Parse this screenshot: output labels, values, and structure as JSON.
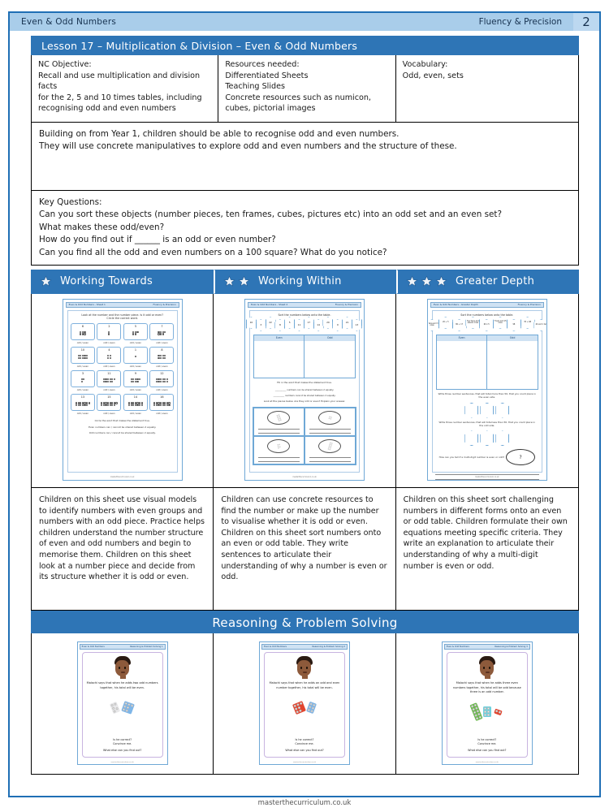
{
  "header": {
    "left_title": "Even & Odd Numbers",
    "right_title": "Fluency & Precision",
    "page_number": "2"
  },
  "lesson": {
    "title": "Lesson 17 – Multiplication & Division – Even & Odd Numbers"
  },
  "info": {
    "nc_objective": {
      "heading": "NC Objective:",
      "lines": [
        "Recall and use multiplication and division facts",
        "for the 2, 5 and 10 times tables, including",
        "recognising odd and even numbers"
      ]
    },
    "resources": {
      "heading": "Resources needed:",
      "lines": [
        "Differentiated Sheets",
        "Teaching Slides",
        "Concrete resources such as numicon,",
        "cubes, pictorial images"
      ]
    },
    "vocabulary": {
      "heading": "Vocabulary:",
      "lines": [
        "Odd, even, sets"
      ]
    }
  },
  "overview": {
    "lines": [
      "Building on from Year 1, children should be able to recognise odd and even numbers.",
      "They will use concrete manipulatives to explore odd and even numbers and the structure of these."
    ]
  },
  "key_questions": {
    "heading": "Key Questions:",
    "lines": [
      "Can you sort these objects (number pieces, ten frames, cubes, pictures etc) into an odd set and an even set?",
      "What makes these odd/even?",
      "How do you find out if ______ is an odd or even number?",
      "Can you find all the odd and even numbers on a 100 square? What do you notice?"
    ]
  },
  "differentiation": [
    {
      "label": "Working Towards",
      "stars": 1,
      "description": "Children on this sheet use visual models to identify numbers with even groups and numbers with an odd piece. Practice helps children understand the number structure of even and odd numbers and begin to memorise them. Children on this sheet look at a number piece and decide from its structure whether it is odd or even."
    },
    {
      "label": "Working Within",
      "stars": 2,
      "description": "Children can use concrete resources to find the number or make up the number to visualise whether it is odd or even. Children on this sheet sort numbers onto an even or odd table. They write sentences to articulate their understanding of why a number is even or odd."
    },
    {
      "label": "Greater Depth",
      "stars": 3,
      "description": "Children on this sheet sort challenging numbers in different forms onto an even or odd table. Children formulate their own equations meeting specific criteria. They write an explanation to articulate their understanding of why a multi-digit number is even or odd."
    }
  ],
  "worksheets": [
    {
      "head_left": "Even & Odd Numbers - Sheet 1",
      "head_right": "Fluency & Precision",
      "title_lines": [
        "Look at the number and the number piece. Is it odd or even?",
        "Circle the correct word."
      ],
      "cards": [
        {
          "number": "6",
          "shape": 6,
          "label": "odd / even"
        },
        {
          "number": "2",
          "shape": 2,
          "label": "odd / even"
        },
        {
          "number": "5",
          "shape": 5,
          "label": "odd / even"
        },
        {
          "number": "7",
          "shape": 7,
          "label": "odd / even"
        },
        {
          "number": "10",
          "shape": 10,
          "label": "odd / even"
        },
        {
          "number": "4",
          "shape": 4,
          "label": "odd / even"
        },
        {
          "number": "1",
          "shape": 1,
          "label": "odd / even"
        },
        {
          "number": "8",
          "shape": 8,
          "label": "odd / even"
        },
        {
          "number": "3",
          "shape": 3,
          "label": "odd / even"
        },
        {
          "number": "11",
          "shape": 11,
          "label": "odd / even"
        },
        {
          "number": "9",
          "shape": 9,
          "label": "odd / even"
        },
        {
          "number": "12",
          "shape": 12,
          "label": "odd / even"
        },
        {
          "number": "13",
          "shape": 13,
          "label": "odd / even"
        },
        {
          "number": "15",
          "shape": 15,
          "label": "odd / even"
        },
        {
          "number": "14",
          "shape": 14,
          "label": "odd / even"
        },
        {
          "number": "16",
          "shape": 16,
          "label": "odd / even"
        }
      ],
      "statement_intro": "Circle the word that makes the statement true.",
      "statements": [
        "Even numbers can / cannot be shared between 2 equally.",
        "Odd numbers can / cannot be shared between 2 equally."
      ],
      "footer": "masterthecurriculum.co.uk"
    },
    {
      "head_left": "Even & Odd Numbers - Sheet 2",
      "head_right": "Fluency & Precision",
      "title_lines": [
        "Sort the numbers below onto the table."
      ],
      "hex_numbers": [
        "6",
        "18",
        "25",
        "10",
        "3",
        "22",
        "8",
        "5",
        "11",
        "17",
        "14",
        "20",
        "9",
        "21",
        "13",
        "16",
        "23",
        "7"
      ],
      "table_headers": [
        "Even",
        "Odd"
      ],
      "mid_instruction": "Fill in the word that makes the statement true.",
      "fill_lines": [
        "__________ numbers can be shared between 2 equally.",
        "__________ numbers cannot be shared between 2 equally."
      ],
      "bottom_instruction": "Look at the pieces below. Are they odd or even? Explain your answer.",
      "footer": "masterthecurriculum.co.uk"
    },
    {
      "head_left": "Even & Odd Numbers - Greater Depth",
      "head_right": "Fluency & Precision",
      "title_lines": [
        "Sort the numbers below onto the table."
      ],
      "hex_numbers": [
        "two tens and six ones",
        "ten tens and 7 ones",
        "17 tens and 3 ones",
        "20 + 5",
        "80 + 17",
        "four tens and eleven ones",
        "60 x 5",
        "7 tens and 15 ones",
        "98",
        "35 + 68",
        "44 and 1 ten",
        "tens only",
        "70 - 11"
      ],
      "table_headers": [
        "Even",
        "Odd"
      ],
      "instruction_1": "Write three number sentences, that will total more than 50, that you could place in the even side.",
      "instruction_2": "Write three number sentences, that will total less than 50, that you could place in the odd side.",
      "instruction_3": "How can you tell if a multi-digit number is even or odd?",
      "footer": "masterthecurriculum.co.uk"
    }
  ],
  "reasoning": {
    "banner": "Reasoning & Problem Solving",
    "cards": [
      {
        "head_left": "Even & Odd Numbers",
        "head_right": "Reasoning & Problem Solving 1",
        "question": "Malachi says that when he adds two odd numbers together, his total will be even.",
        "prompt_1": "Is he correct?",
        "prompt_2": "Convince me.",
        "prompt_3": "What else can you find out?",
        "footer": "masterthecurriculum.co.uk"
      },
      {
        "head_left": "Even & Odd Numbers",
        "head_right": "Reasoning & Problem Solving 2",
        "question": "Malachi says that when he adds an odd and even number together, his total will be even.",
        "prompt_1": "Is he correct?",
        "prompt_2": "Convince me.",
        "prompt_3": "What else can you find out?",
        "footer": "masterthecurriculum.co.uk"
      },
      {
        "head_left": "Even & Odd Numbers",
        "head_right": "Reasoning & Problem Solving 3",
        "question": "Malachi says that when he adds three even numbers together, his total will be odd because three is an odd number.",
        "prompt_1": "Is he correct?",
        "prompt_2": "Convince me.",
        "prompt_3": "What else can you find out?",
        "footer": "masterthecurriculum.co.uk"
      }
    ]
  },
  "footer": {
    "text": "masterthecurriculum.co.uk"
  },
  "colors": {
    "header_light_blue": "#a9cdea",
    "banner_blue": "#2e75b6",
    "sheet_border_blue": "#6fa8d6",
    "table_header_blue": "#cfe2f3"
  }
}
